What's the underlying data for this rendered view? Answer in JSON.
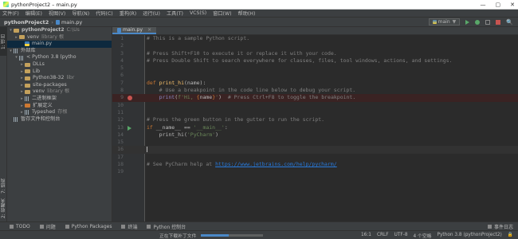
{
  "window": {
    "title": "pythonProject2 – main.py",
    "controls": [
      "—",
      "▢",
      "✕"
    ]
  },
  "menu": [
    "文件(F)",
    "编辑(E)",
    "视图(V)",
    "导航(N)",
    "代码(C)",
    "重构(R)",
    "运行(U)",
    "工具(T)",
    "VCS(S)",
    "窗口(W)",
    "帮助(H)"
  ],
  "navbar": {
    "project": "pythonProject2",
    "file": "main.py",
    "run_config": "main",
    "nav_glyphs": [
      "▼",
      "🔍"
    ]
  },
  "left_tabs": {
    "project": "1: 项目",
    "structure": "7: 结构",
    "favorites": "2: 收藏夹"
  },
  "project_tree": [
    {
      "indent": 0,
      "chev": "v",
      "icon": "folder",
      "label": "pythonProject2",
      "dim": "C:\\Us",
      "bold": true
    },
    {
      "indent": 1,
      "chev": ">",
      "icon": "folder",
      "label": "venv",
      "dim": "library 根"
    },
    {
      "indent": 2,
      "chev": "",
      "icon": "pyfile",
      "label": "main.py",
      "selected": true
    },
    {
      "indent": 0,
      "chev": "v",
      "icon": "lib",
      "label": "外部库"
    },
    {
      "indent": 1,
      "chev": "v",
      "icon": "lib",
      "label": "< Python 3.8 (pytho"
    },
    {
      "indent": 2,
      "chev": ">",
      "icon": "folder",
      "label": "DLLs"
    },
    {
      "indent": 2,
      "chev": ">",
      "icon": "folder",
      "label": "Lib"
    },
    {
      "indent": 2,
      "chev": ">",
      "icon": "folder",
      "label": "Python38-32",
      "dim": "libr"
    },
    {
      "indent": 2,
      "chev": ">",
      "icon": "folder",
      "label": "site-packages"
    },
    {
      "indent": 2,
      "chev": ">",
      "icon": "folder",
      "label": "venv",
      "dim": "library 根"
    },
    {
      "indent": 2,
      "chev": ">",
      "icon": "lib",
      "label": "二进制框架"
    },
    {
      "indent": 2,
      "chev": ">",
      "icon": "folder-orange",
      "label": "扩展定义"
    },
    {
      "indent": 2,
      "chev": ">",
      "icon": "lib",
      "label": "Typeshed",
      "dim": "存根"
    },
    {
      "indent": 0,
      "chev": "",
      "icon": "lib",
      "label": "暂存文件和控制台"
    }
  ],
  "editor": {
    "tab": "main.py",
    "tab_close": "×",
    "lines": [
      {
        "n": "1",
        "html": "<span class='cm'># This is a sample Python script.</span>"
      },
      {
        "n": "2",
        "html": ""
      },
      {
        "n": "3",
        "html": "<span class='cm'># Press Shift+F10 to execute it or replace it with your code.</span>"
      },
      {
        "n": "4",
        "html": "<span class='cm'># Press Double Shift to search everywhere for classes, files, tool windows, actions, and settings.</span>"
      },
      {
        "n": "5",
        "html": ""
      },
      {
        "n": "6",
        "html": ""
      },
      {
        "n": "7",
        "html": "<span class='kw'>def</span> <span class='fn'>print_hi</span>(name):"
      },
      {
        "n": "8",
        "html": "    <span class='cm'># Use a breakpoint in the code line below to debug your script.</span>"
      },
      {
        "n": "9",
        "html": "    <span class='bl'>print</span>(<span class='str'>f'Hi, </span><span class='kw'>{</span>name<span class='kw'>}</span><span class='str'>'</span>)  <span class='cm'># Press Ctrl+F8 to toggle the breakpoint.</span>",
        "bp": true
      },
      {
        "n": "10",
        "html": ""
      },
      {
        "n": "11",
        "html": ""
      },
      {
        "n": "12",
        "html": "<span class='cm'># Press the green button in the gutter to run the script.</span>"
      },
      {
        "n": "13",
        "html": "<span class='kw'>if</span> __name__ == <span class='str'>'__main__'</span>:",
        "run": true
      },
      {
        "n": "14",
        "html": "    print_hi(<span class='str'>'PyCharm'</span>)"
      },
      {
        "n": "15",
        "html": ""
      },
      {
        "n": "16",
        "html": "<span class='cursor'></span>",
        "current": true
      },
      {
        "n": "17",
        "html": ""
      },
      {
        "n": "18",
        "html": "<span class='cm'># See PyCharm help at </span><span class='cm link'>https://www.jetbrains.com/help/pycharm/</span>"
      },
      {
        "n": "19",
        "html": ""
      }
    ]
  },
  "bottom_tabs": [
    "TODO",
    "问题",
    "Python Packages",
    "终端",
    "Python 控制台"
  ],
  "event_log": "事件日志",
  "status": {
    "message": "正在下载补丁文件",
    "progress": 0.45,
    "position": "16:1",
    "line_sep": "CRLF",
    "encoding": "UTF-8",
    "indent": "4 个空格",
    "interpreter": "Python 3.8 (pythonProject2)"
  },
  "colors": {
    "accent": "#4a88c7",
    "breakpoint": "#c75450",
    "run": "#59a869"
  }
}
